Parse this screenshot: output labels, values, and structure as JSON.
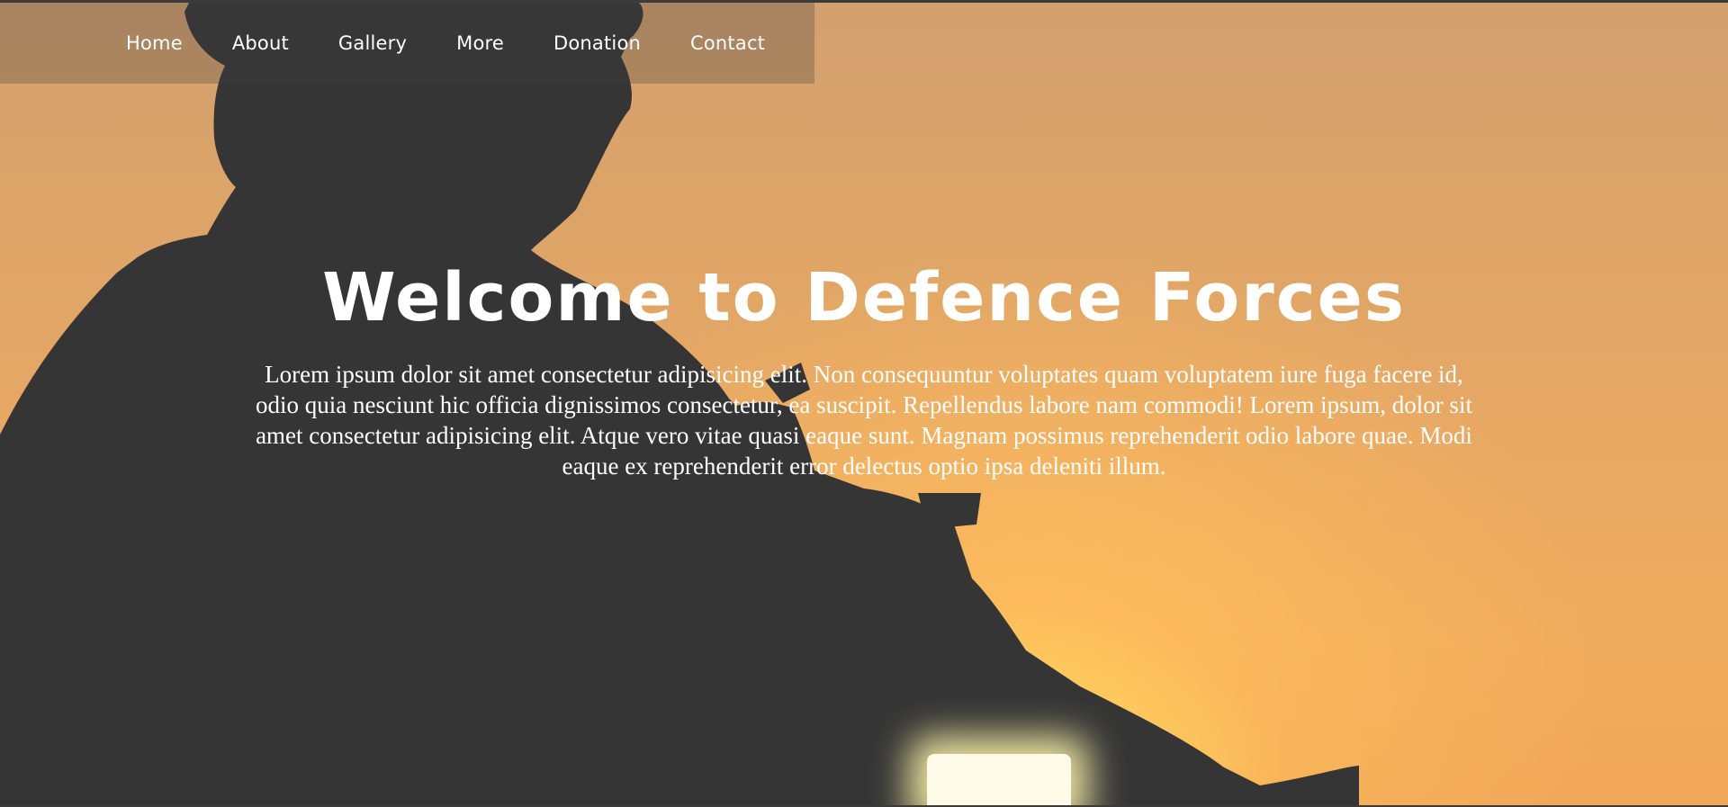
{
  "nav": {
    "items": [
      {
        "label": "Home"
      },
      {
        "label": "About"
      },
      {
        "label": "Gallery"
      },
      {
        "label": "More"
      },
      {
        "label": "Donation"
      },
      {
        "label": "Contact"
      }
    ]
  },
  "hero": {
    "title": "Welcome to Defence Forces",
    "description": "Lorem ipsum dolor sit amet consectetur adipisicing elit. Non consequuntur voluptates quam voluptatem iure fuga facere id, odio quia nesciunt hic officia dignissimos consectetur, ea suscipit. Repellendus labore nam commodi! Lorem ipsum, dolor sit amet consectetur adipisicing elit. Atque vero vitae quasi eaque sunt. Magnam possimus reprehenderit odio labore quae. Modi eaque ex reprehenderit error delectus optio ipsa deleniti illum."
  },
  "colors": {
    "overlay_dark": "#333333",
    "sky_orange": "#e8a864",
    "sun_glow": "#fff27a",
    "text": "#ffffff"
  }
}
